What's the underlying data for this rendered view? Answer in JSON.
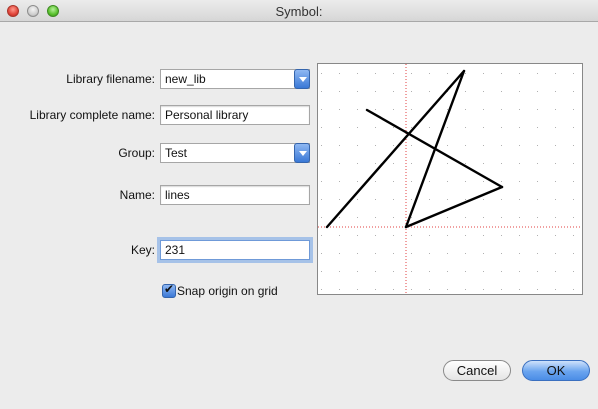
{
  "window": {
    "title": "Symbol:"
  },
  "form": {
    "library_filename": {
      "label": "Library filename:",
      "value": "new_lib"
    },
    "library_complete_name": {
      "label": "Library complete name:",
      "value": "Personal library"
    },
    "group": {
      "label": "Group:",
      "value": "Test"
    },
    "name": {
      "label": "Name:",
      "value": "lines"
    },
    "key": {
      "label": "Key:",
      "value": "231"
    },
    "snap": {
      "label": "Snap origin on grid",
      "checked": true
    }
  },
  "buttons": {
    "cancel": "Cancel",
    "ok": "OK"
  },
  "colors": {
    "accent": "#3a78d6",
    "grid_origin": "#e04040",
    "grid_dots": "#b0b0b0"
  }
}
